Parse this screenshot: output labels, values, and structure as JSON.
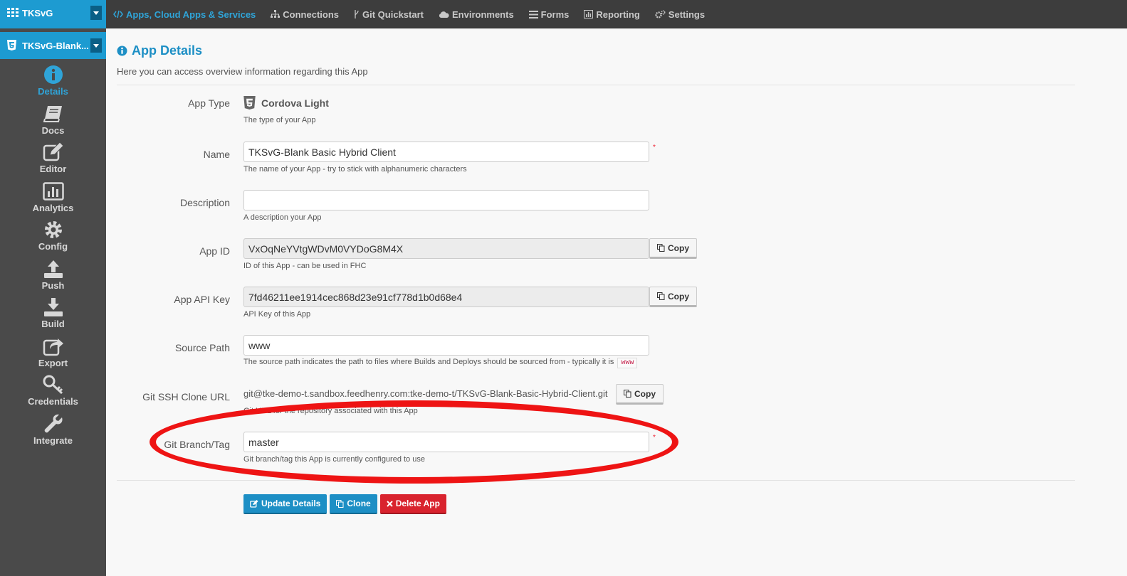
{
  "project": {
    "name": "TKSvG"
  },
  "nav": {
    "items": [
      {
        "label": "Apps, Cloud Apps & Services",
        "icon": "code-icon",
        "active": true
      },
      {
        "label": "Connections",
        "icon": "sitemap-icon"
      },
      {
        "label": "Git Quickstart",
        "icon": "git-branch-icon"
      },
      {
        "label": "Environments",
        "icon": "cloud-icon"
      },
      {
        "label": "Forms",
        "icon": "list-icon"
      },
      {
        "label": "Reporting",
        "icon": "bar-chart-icon"
      },
      {
        "label": "Settings",
        "icon": "cogs-icon"
      }
    ]
  },
  "app": {
    "name": "TKSvG-Blank..."
  },
  "sidebar": {
    "items": [
      {
        "label": "Details",
        "icon": "info-circle-icon",
        "active": true
      },
      {
        "label": "Docs",
        "icon": "book-icon"
      },
      {
        "label": "Editor",
        "icon": "edit-icon"
      },
      {
        "label": "Analytics",
        "icon": "bar-chart-icon"
      },
      {
        "label": "Config",
        "icon": "gear-icon"
      },
      {
        "label": "Push",
        "icon": "upload-icon"
      },
      {
        "label": "Build",
        "icon": "download-icon"
      },
      {
        "label": "Export",
        "icon": "share-icon"
      },
      {
        "label": "Credentials",
        "icon": "key-icon"
      },
      {
        "label": "Integrate",
        "icon": "wrench-icon"
      }
    ]
  },
  "page": {
    "title": "App Details",
    "subtitle": "Here you can access overview information regarding this App"
  },
  "form": {
    "app_type": {
      "label": "App Type",
      "value": "Cordova Light",
      "help": "The type of your App"
    },
    "name": {
      "label": "Name",
      "value": "TKSvG-Blank Basic Hybrid Client",
      "help": "The name of your App - try to stick with alphanumeric characters",
      "required": "*"
    },
    "description": {
      "label": "Description",
      "value": "",
      "help": "A description your App"
    },
    "app_id": {
      "label": "App ID",
      "value": "VxOqNeYVtgWDvM0VYDoG8M4X",
      "help": "ID of this App - can be used in FHC",
      "copy_label": "Copy"
    },
    "api_key": {
      "label": "App API Key",
      "value": "7fd46211ee1914cec868d23e91cf778d1b0d68e4",
      "help": "API Key of this App",
      "copy_label": "Copy"
    },
    "source_path": {
      "label": "Source Path",
      "value": "www",
      "help": "The source path indicates the path to files where Builds and Deploys should be sourced from - typically it is",
      "help_code": "www"
    },
    "git_url": {
      "label": "Git SSH Clone URL",
      "value": "git@tke-demo-t.sandbox.feedhenry.com:tke-demo-t/TKSvG-Blank-Basic-Hybrid-Client.git",
      "help": "Git URL for the repository associated with this App",
      "copy_label": "Copy"
    },
    "git_branch": {
      "label": "Git Branch/Tag",
      "value": "master",
      "help": "Git branch/tag this App is currently configured to use",
      "required": "*"
    }
  },
  "actions": {
    "update": "Update Details",
    "clone": "Clone",
    "delete": "Delete App"
  },
  "colors": {
    "accent": "#1d9bd1",
    "danger": "#d9232e",
    "highlight": "#ee1414"
  }
}
